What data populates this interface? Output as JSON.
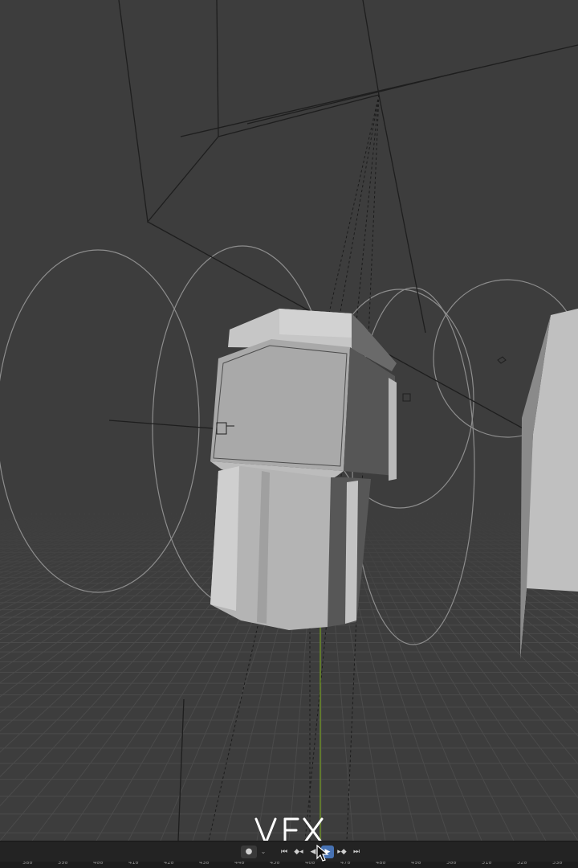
{
  "watermark": {
    "text": "VFX"
  },
  "timeline": {
    "buttons": [
      {
        "name": "keyframe-dot-button",
        "icon": "record-dot-icon",
        "glyph": "●"
      },
      {
        "name": "keying-dropdown",
        "icon": "chevron-down-icon",
        "glyph": "⌄"
      },
      {
        "name": "jump-to-start-button",
        "icon": "jump-start-icon",
        "glyph": "⏮"
      },
      {
        "name": "prev-keyframe-button",
        "icon": "prev-keyframe-icon",
        "glyph": "◆◂"
      },
      {
        "name": "play-reverse-button",
        "icon": "play-reverse-icon",
        "glyph": "◀"
      },
      {
        "name": "play-button",
        "icon": "play-icon",
        "glyph": "▶",
        "active": true
      },
      {
        "name": "next-keyframe-button",
        "icon": "next-keyframe-icon",
        "glyph": "▸◆"
      },
      {
        "name": "jump-to-end-button",
        "icon": "jump-end-icon",
        "glyph": "⏭"
      }
    ],
    "frame_numbers": [
      "380",
      "390",
      "400",
      "410",
      "420",
      "430",
      "440",
      "450",
      "460",
      "470",
      "480",
      "490",
      "500",
      "510",
      "520",
      "530",
      "540"
    ]
  },
  "colors": {
    "viewport_bg": "#3d3d3d",
    "grid": "#4a4a4a",
    "mesh_light": "#bdbdbd",
    "mesh_dark": "#525252",
    "light_circles": "#8a8a8a",
    "timeline_active": "#4772b3",
    "z_axis": "#6b8e23"
  }
}
